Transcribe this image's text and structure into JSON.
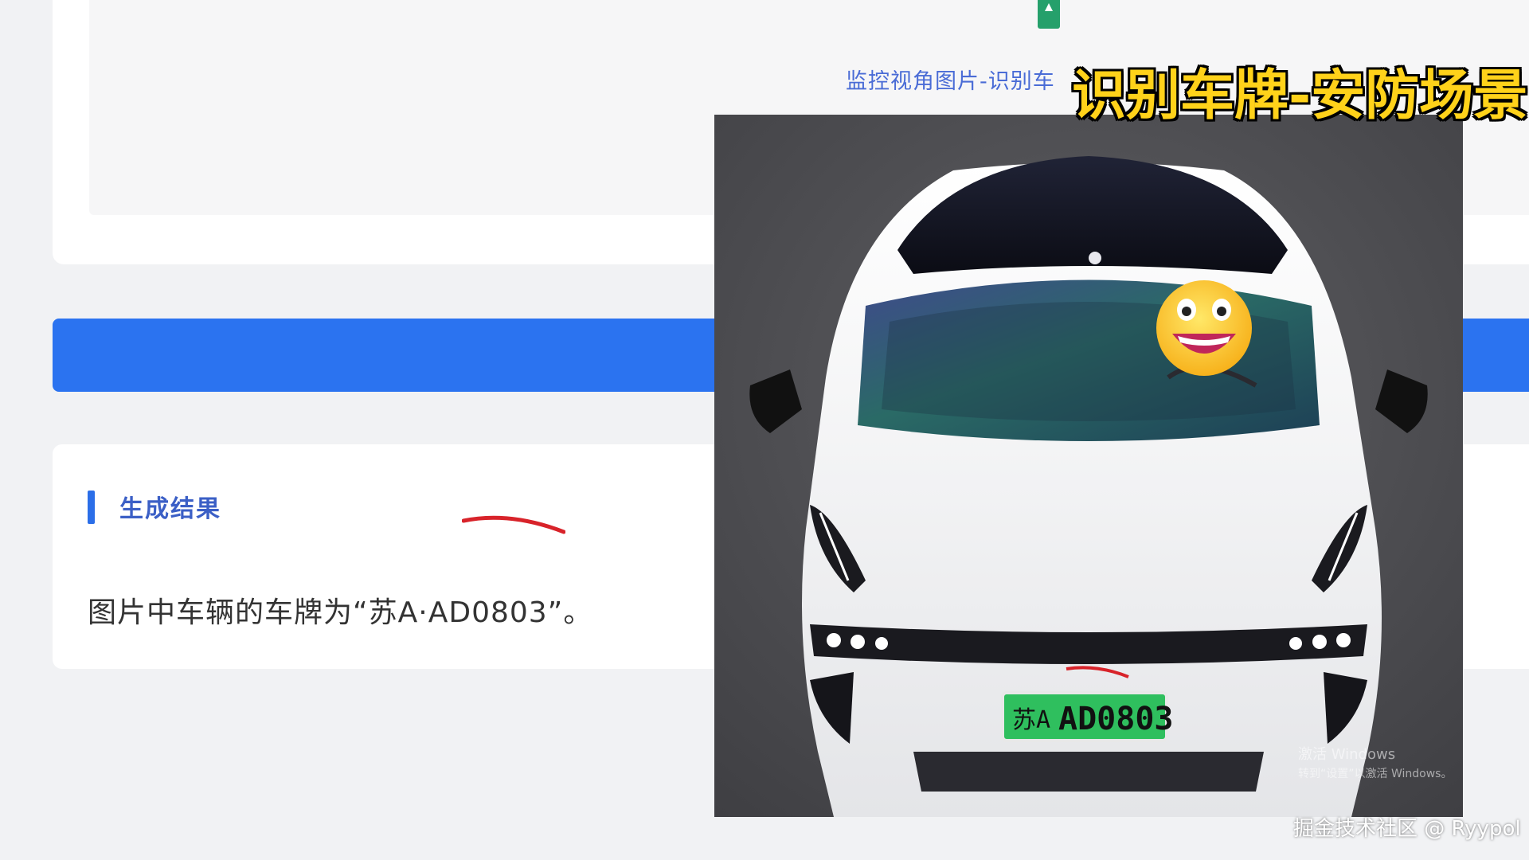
{
  "upload_panel": {
    "file_icon": "image-file-icon",
    "file_name": "监控视角图片-识别车"
  },
  "overlay": {
    "title": "识别车牌-安防场景"
  },
  "result": {
    "section_title": "生成结果",
    "text": "图片中车辆的车牌为“苏A·AD0803”。"
  },
  "photo": {
    "plate_province": "苏A",
    "plate_number": "AD0803",
    "plate_color": "#2fbf5e",
    "driver_face_icon": "grinning-face-emoji"
  },
  "watermark": {
    "line1": "激活 Windows",
    "line2": "转到“设置”以激活 Windows。"
  },
  "credit": "掘金技术社区 @ Ryypol",
  "colors": {
    "accent_blue": "#2b73f0",
    "title_yellow": "#ffd21a",
    "annotation_red": "#d8232a"
  }
}
